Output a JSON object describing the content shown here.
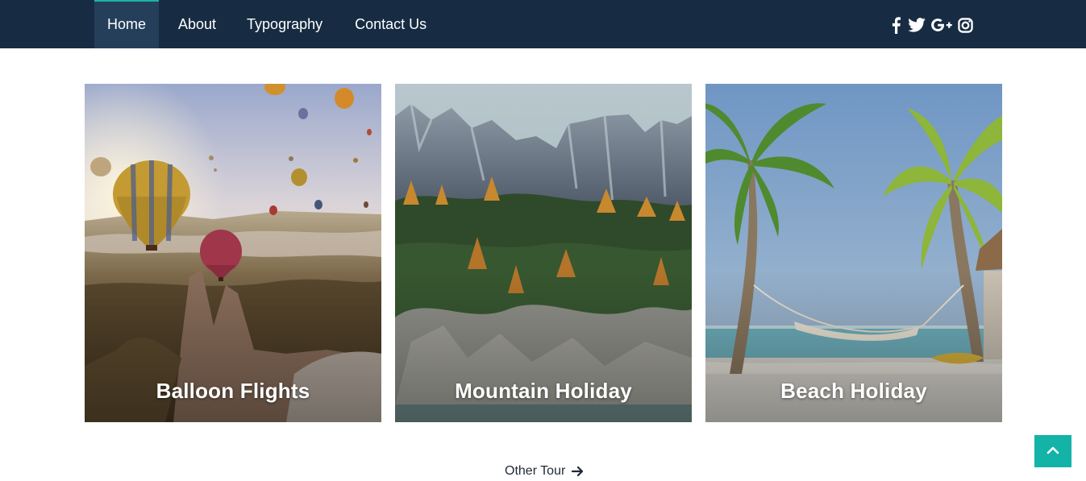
{
  "nav": {
    "items": [
      {
        "label": "Home",
        "active": true
      },
      {
        "label": "About",
        "active": false
      },
      {
        "label": "Typography",
        "active": false
      },
      {
        "label": "Contact Us",
        "active": false
      }
    ],
    "social_icons": [
      "facebook-icon",
      "twitter-icon",
      "google-plus-icon",
      "instagram-icon"
    ]
  },
  "cards": [
    {
      "title": "Balloon Flights"
    },
    {
      "title": "Mountain Holiday"
    },
    {
      "title": "Beach Holiday"
    }
  ],
  "other_tour": {
    "label": "Other Tour",
    "icon": "arrow-right-icon"
  },
  "back_to_top": {
    "icon": "chevron-up-icon"
  },
  "colors": {
    "navbar_bg": "#172c42",
    "nav_active_bg": "#253f5a",
    "accent": "#13b3a7",
    "text_dark": "#1f2933"
  }
}
